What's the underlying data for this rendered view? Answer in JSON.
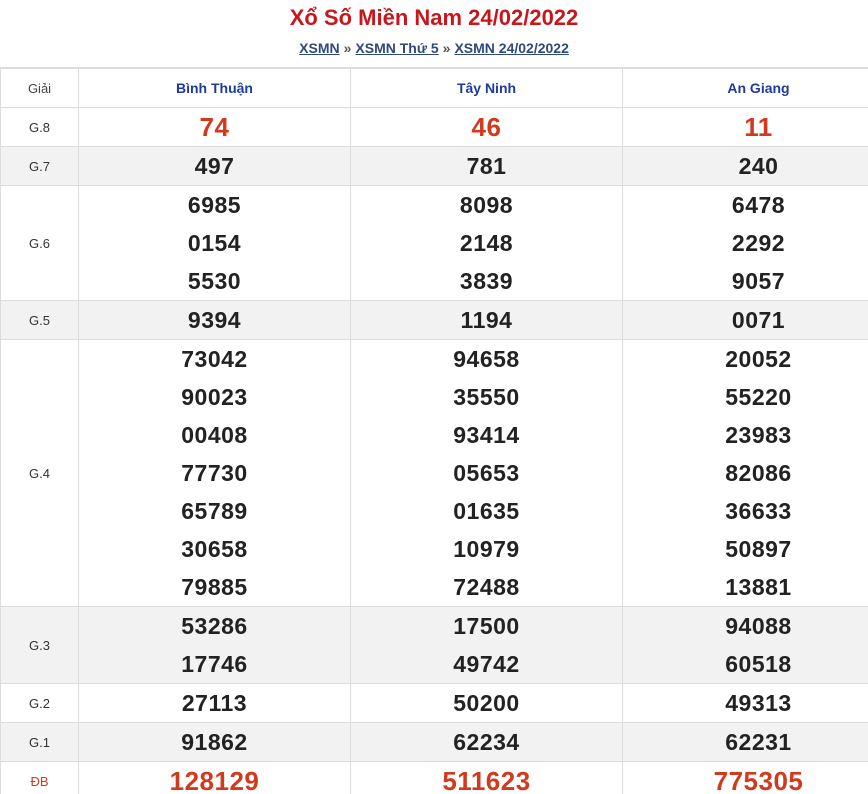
{
  "header": {
    "title": "Xổ Số Miền Nam 24/02/2022",
    "breadcrumb": [
      "XSMN",
      "XSMN Thứ 5",
      "XSMN 24/02/2022"
    ],
    "separator": "»"
  },
  "table": {
    "col_label": "Giải",
    "provinces": [
      "Bình Thuận",
      "Tây Ninh",
      "An Giang"
    ],
    "rows": [
      {
        "label": "G.8",
        "alt": false,
        "red": true,
        "values": [
          [
            "74"
          ],
          [
            "46"
          ],
          [
            "11"
          ]
        ]
      },
      {
        "label": "G.7",
        "alt": true,
        "red": false,
        "values": [
          [
            "497"
          ],
          [
            "781"
          ],
          [
            "240"
          ]
        ]
      },
      {
        "label": "G.6",
        "alt": false,
        "red": false,
        "values": [
          [
            "6985",
            "0154",
            "5530"
          ],
          [
            "8098",
            "2148",
            "3839"
          ],
          [
            "6478",
            "2292",
            "9057"
          ]
        ]
      },
      {
        "label": "G.5",
        "alt": true,
        "red": false,
        "values": [
          [
            "9394"
          ],
          [
            "1194"
          ],
          [
            "0071"
          ]
        ]
      },
      {
        "label": "G.4",
        "alt": false,
        "red": false,
        "values": [
          [
            "73042",
            "90023",
            "00408",
            "77730",
            "65789",
            "30658",
            "79885"
          ],
          [
            "94658",
            "35550",
            "93414",
            "05653",
            "01635",
            "10979",
            "72488"
          ],
          [
            "20052",
            "55220",
            "23983",
            "82086",
            "36633",
            "50897",
            "13881"
          ]
        ]
      },
      {
        "label": "G.3",
        "alt": true,
        "red": false,
        "values": [
          [
            "53286",
            "17746"
          ],
          [
            "17500",
            "49742"
          ],
          [
            "94088",
            "60518"
          ]
        ]
      },
      {
        "label": "G.2",
        "alt": false,
        "red": false,
        "values": [
          [
            "27113"
          ],
          [
            "50200"
          ],
          [
            "49313"
          ]
        ]
      },
      {
        "label": "G.1",
        "alt": true,
        "red": false,
        "values": [
          [
            "91862"
          ],
          [
            "62234"
          ],
          [
            "62231"
          ]
        ]
      },
      {
        "label": "ĐB",
        "alt": false,
        "red": true,
        "values": [
          [
            "128129"
          ],
          [
            "511623"
          ],
          [
            "775305"
          ]
        ]
      }
    ]
  },
  "colors": {
    "title": "#c8161d",
    "link": "#2e4a7d",
    "province": "#1f3a9e",
    "special": "#d23a1e",
    "alt_row": "#f2f2f2"
  }
}
